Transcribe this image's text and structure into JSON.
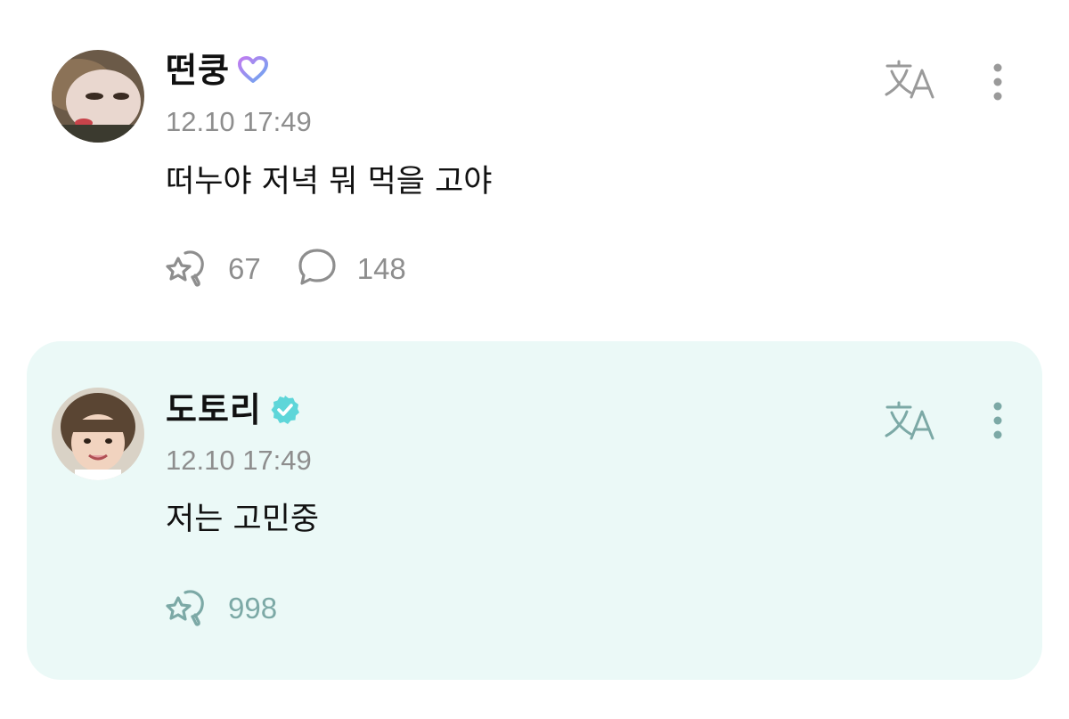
{
  "colors": {
    "reply_background": "#ebf9f7",
    "text_primary": "#111111",
    "text_secondary": "#8e8e8e",
    "icon_gray": "#8e8e8e",
    "artist_badge": "#5ed6d9",
    "fan_badge_gradient": [
      "#c07cf0",
      "#6aa8f0"
    ],
    "reply_icon": "#7ca9a6"
  },
  "posts": [
    {
      "author": "떤쿵",
      "badge_icon": "heart-badge-icon",
      "timestamp": "12.10 17:49",
      "message": "떠누야 저녁 뭐 먹을 고야",
      "like_count": "67",
      "comment_count": "148",
      "translate_icon": "translate-icon",
      "more_icon": "more-vertical-icon"
    },
    {
      "author": "도토리",
      "badge_icon": "verified-badge-icon",
      "timestamp": "12.10 17:49",
      "message": "저는 고민중",
      "like_count": "998",
      "translate_icon": "translate-icon",
      "more_icon": "more-vertical-icon"
    }
  ]
}
